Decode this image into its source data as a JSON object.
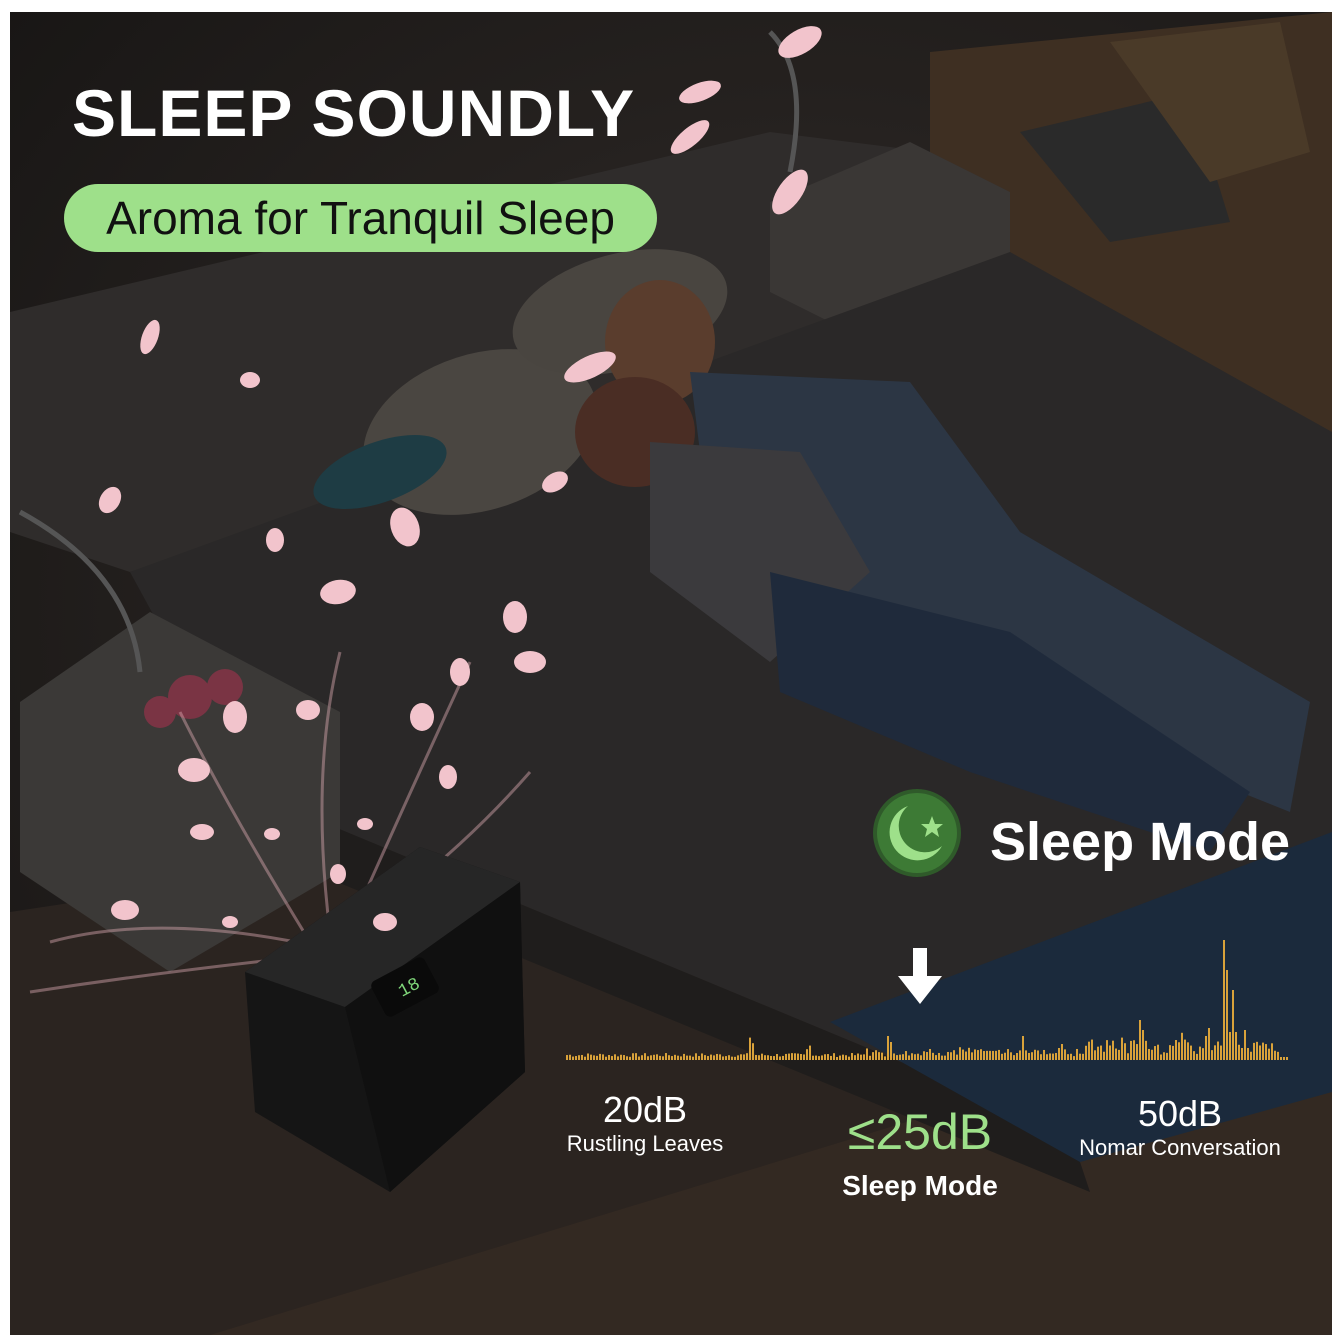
{
  "headline": "SLEEP SOUNDLY",
  "subheadline": "Aroma for Tranquil Sleep",
  "mode": {
    "title": "Sleep Mode",
    "icon": "moon-star-icon",
    "arrow_icon": "down-arrow-icon"
  },
  "levels": [
    {
      "value": "20dB",
      "label": "Rustling Leaves"
    },
    {
      "value": "≤25dB",
      "label": "Sleep Mode"
    },
    {
      "value": "50dB",
      "label": "Nomar Conversation"
    }
  ],
  "device_display": "18",
  "colors": {
    "accent_green": "#9ee08a",
    "wave_gold": "#d9a23a",
    "text_white": "#ffffff"
  }
}
